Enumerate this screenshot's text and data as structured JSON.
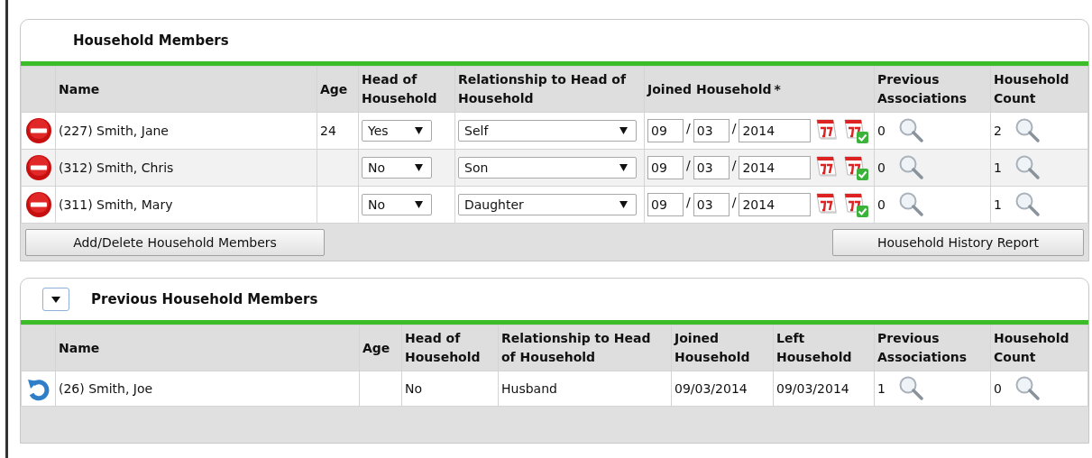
{
  "household_members": {
    "title": "Household Members",
    "columns": [
      {
        "label": "Name"
      },
      {
        "label": "Age"
      },
      {
        "label": "Head of Household"
      },
      {
        "label": "Relationship to Head of Household"
      },
      {
        "label": "Joined Household",
        "marker": "*"
      },
      {
        "label": "Previous Associations"
      },
      {
        "label": "Household Count"
      }
    ],
    "date_separator": "/",
    "rows": [
      {
        "name": "(227) Smith, Jane",
        "age": "24",
        "head_of_household": "Yes",
        "relationship": "Self",
        "joined": {
          "month": "09",
          "day": "03",
          "year": "2014"
        },
        "previous_associations": "0",
        "household_count": "2"
      },
      {
        "name": "(312) Smith, Chris",
        "head_of_household": "No",
        "relationship": "Son",
        "joined": {
          "month": "09",
          "day": "03",
          "year": "2014"
        },
        "previous_associations": "0",
        "household_count": "1"
      },
      {
        "name": "(311) Smith, Mary",
        "head_of_household": "No",
        "relationship": "Daughter",
        "joined": {
          "month": "09",
          "day": "03",
          "year": "2014"
        },
        "previous_associations": "0",
        "household_count": "1"
      }
    ],
    "buttons": [
      "Add/Delete Household Members",
      "Household History Report"
    ]
  },
  "previous_household_members": {
    "title": "Previous Household Members",
    "expanded": true,
    "columns": [
      {
        "label": "Name"
      },
      {
        "label": "Age"
      },
      {
        "label": "Head of Household"
      },
      {
        "label": "Relationship to Head of Household"
      },
      {
        "label": "Joined Household"
      },
      {
        "label": "Left Household"
      },
      {
        "label": "Previous Associations"
      },
      {
        "label": "Household Count"
      }
    ],
    "rows": [
      {
        "name": "(26) Smith, Joe",
        "head_of_household": "No",
        "relationship": "Husband",
        "joined": "09/03/2014",
        "left": "09/03/2014",
        "previous_associations": "1",
        "household_count": "0"
      }
    ]
  }
}
